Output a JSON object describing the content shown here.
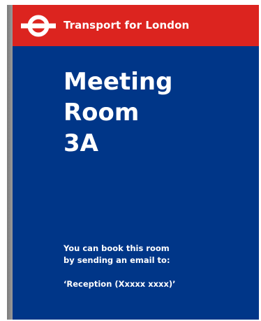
{
  "header": {
    "brand": "Transport for London",
    "logo": "tfl-roundel-icon"
  },
  "room": {
    "title_lines": [
      "Meeting",
      "Room",
      "3A"
    ]
  },
  "booking": {
    "line1": "You can book this room",
    "line2": "by sending an email to:",
    "contact": "‘Reception (Xxxxx xxxx)’"
  },
  "colors": {
    "header_red": "#dc241f",
    "background_blue": "#003688",
    "text": "#ffffff"
  }
}
